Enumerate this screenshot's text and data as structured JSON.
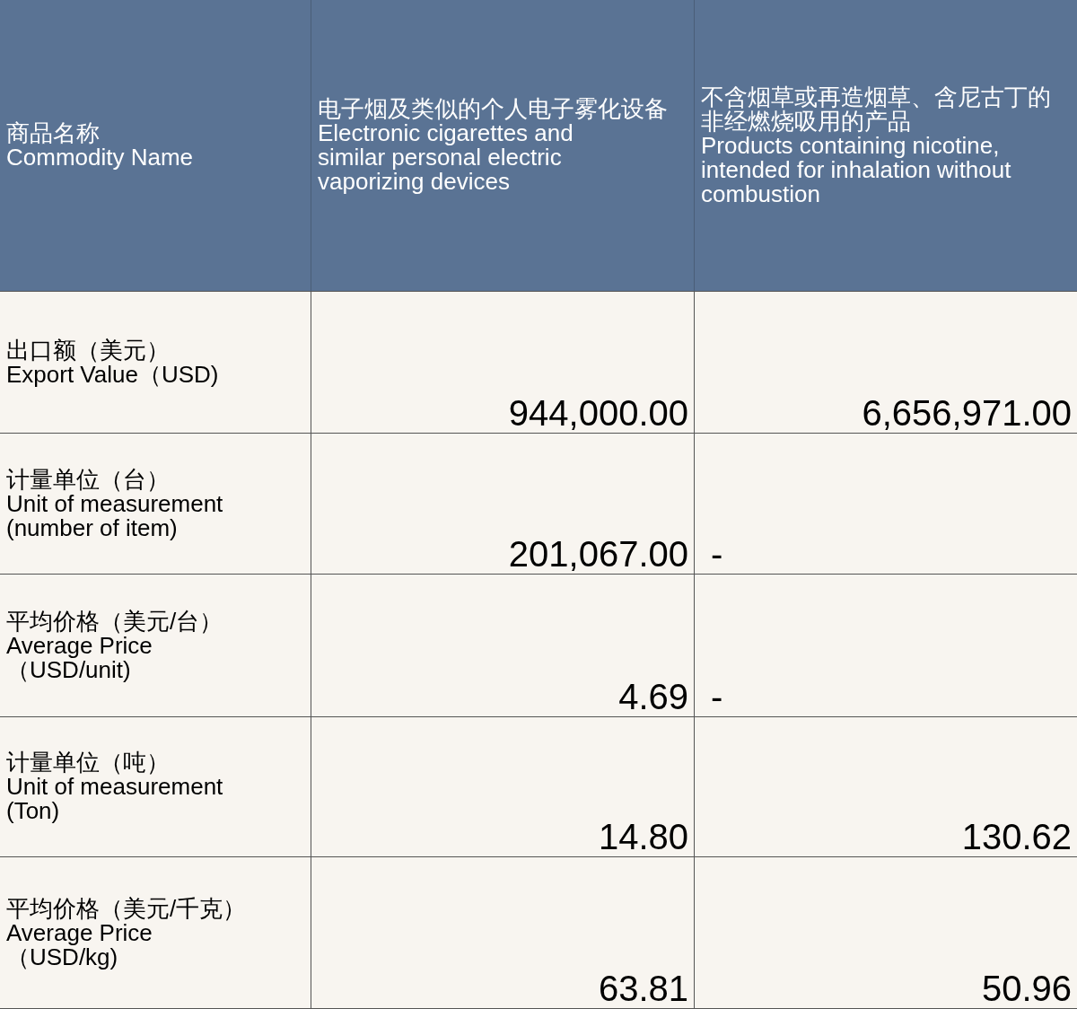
{
  "table": {
    "columns": [
      {
        "zh": [
          "商品名称"
        ],
        "en": "Commodity Name"
      },
      {
        "zh": [
          "电子烟及类似的个人电子雾化设备"
        ],
        "en": "Electronic cigarettes and\nsimilar personal electric\nvaporizing devices"
      },
      {
        "zh": [
          "不含烟草或再造烟草、含尼古丁的",
          "非经燃烧吸用的产品"
        ],
        "en": "Products containing nicotine,\nintended for inhalation without\ncombustion"
      }
    ],
    "rows": [
      {
        "cells": [
          {
            "kind": "label",
            "zh": "出口额（美元）",
            "en": " Export Value（USD)"
          },
          {
            "kind": "value",
            "text": "944,000.00"
          },
          {
            "kind": "value",
            "text": "6,656,971.00"
          }
        ]
      },
      {
        "cells": [
          {
            "kind": "label",
            "zh": "计量单位（台）",
            "en": "Unit of measurement\n(number of item)"
          },
          {
            "kind": "value",
            "text": "201,067.00"
          },
          {
            "kind": "dash",
            "text": "-"
          }
        ]
      },
      {
        "cells": [
          {
            "kind": "label",
            "zh": "平均价格（美元/台）",
            "en": "Average Price\n（USD/unit)"
          },
          {
            "kind": "value",
            "text": "4.69"
          },
          {
            "kind": "dash",
            "text": "-"
          }
        ]
      },
      {
        "cells": [
          {
            "kind": "label",
            "zh": "计量单位（吨）",
            "en": "Unit of measurement\n(Ton)"
          },
          {
            "kind": "value",
            "text": "14.80"
          },
          {
            "kind": "value",
            "text": "130.62"
          }
        ]
      },
      {
        "cells": [
          {
            "kind": "label",
            "zh": "平均价格（美元/千克）",
            "en": "Average Price\n（USD/kg)"
          },
          {
            "kind": "value",
            "text": "63.81"
          },
          {
            "kind": "value",
            "text": "50.96"
          }
        ]
      }
    ]
  }
}
